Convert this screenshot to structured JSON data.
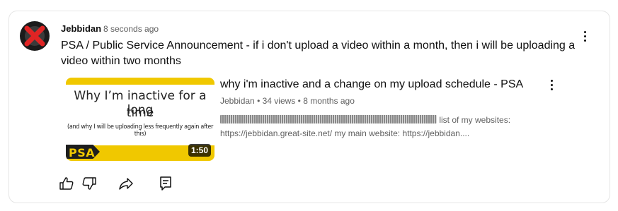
{
  "comment": {
    "author": "Jebbidan",
    "timestamp": "8 seconds ago",
    "text": "PSA / Public Service Announcement - if i don't upload a video within a month, then i will be uploading a video within two months"
  },
  "video": {
    "title": "why i'm inactive and a change on my upload schedule - PSA",
    "channel": "Jebbidan",
    "views": "34 views",
    "age": "8 months ago",
    "separator": "•",
    "description_line1": "list of my websites:",
    "description_line2": "https://jebbidan.great-site.net/ my main website: https://jebbidan....",
    "duration": "1:50",
    "thumbnail": {
      "line1": "Why I’m inactive for a long",
      "line2": "time",
      "line3": "(and why I will be uploading less frequently again after this)",
      "tag": "PSA"
    }
  },
  "colors": {
    "accent_yellow": "#f0c800",
    "avatar_red": "#e02424",
    "text_primary": "#0f0f0f",
    "text_secondary": "#606060"
  },
  "icons": [
    "more-vert-icon",
    "thumb-up-icon",
    "thumb-down-icon",
    "share-icon",
    "comment-icon"
  ]
}
